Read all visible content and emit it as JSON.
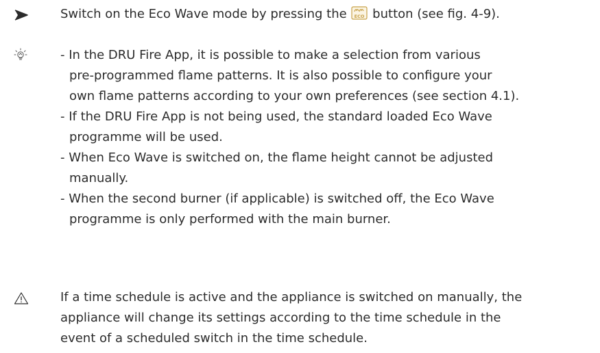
{
  "step": {
    "marker_icon": "arrowhead-bullet-icon",
    "text_before_icon": "Switch on the Eco Wave mode by pressing the",
    "button_icon": "eco-wave-button-icon",
    "text_after_icon": "button (see fig. 4-9)."
  },
  "tip": {
    "marker_icon": "lightbulb-tip-icon",
    "bullets": [
      {
        "lines": [
          "- In the DRU Fire App, it is possible to make a selection from various",
          "pre-programmed flame patterns. It is also possible to configure your",
          "own flame patterns according to your own preferences (see section 4.1)."
        ]
      },
      {
        "lines": [
          "- If the DRU Fire App is not being used, the standard loaded Eco Wave",
          "programme will be used."
        ]
      },
      {
        "lines": [
          "- When Eco Wave is switched on, the flame height cannot be adjusted",
          "manually."
        ]
      },
      {
        "lines": [
          "- When the second burner (if applicable) is switched off, the Eco Wave",
          "programme is only performed with the main burner."
        ]
      }
    ]
  },
  "warning": {
    "marker_icon": "warning-triangle-icon",
    "lines": [
      "If a time schedule is active and the appliance is switched on manually, the",
      "appliance will change its settings according to the time schedule in the",
      "event of a scheduled switch in the time schedule."
    ]
  },
  "colors": {
    "text": "#2b2b2b",
    "eco_icon": "#c8a24a"
  }
}
